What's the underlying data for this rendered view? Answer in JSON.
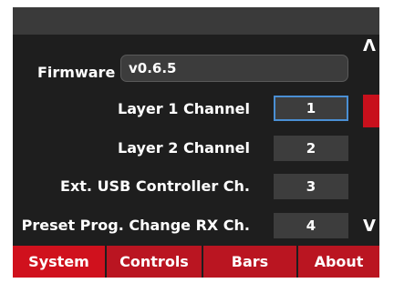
{
  "settings": {
    "firmware": {
      "label": "Firmware",
      "value": "v0.6.5"
    },
    "rows": [
      {
        "label": "Layer 1 Channel",
        "value": "1"
      },
      {
        "label": "Layer 2 Channel",
        "value": "2"
      },
      {
        "label": "Ext. USB Controller Ch.",
        "value": "3"
      },
      {
        "label": "Preset Prog. Change RX Ch.",
        "value": "4"
      }
    ]
  },
  "scroll": {
    "up_glyph": "Λ",
    "down_glyph": "V"
  },
  "tabs": [
    {
      "label": "System",
      "active": true
    },
    {
      "label": "Controls",
      "active": false
    },
    {
      "label": "Bars",
      "active": false
    },
    {
      "label": "About",
      "active": false
    }
  ],
  "colors": {
    "accent": "#c8101c",
    "selection": "#4a8fd4",
    "background": "#1e1e1e"
  }
}
